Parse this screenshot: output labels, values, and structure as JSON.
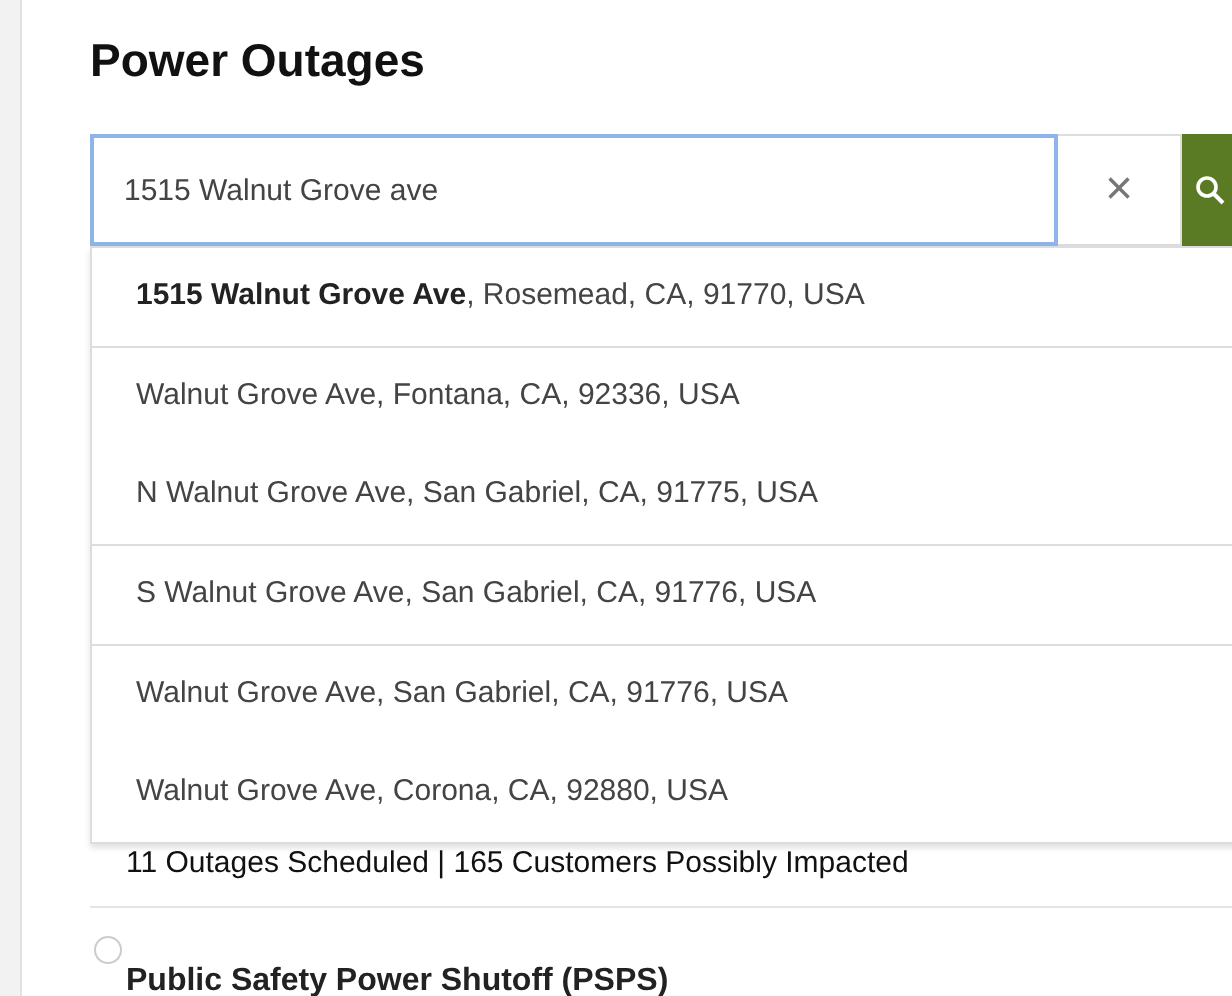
{
  "title": "Power Outages",
  "search": {
    "value": "1515 Walnut Grove ave",
    "clear_label": "×"
  },
  "suggestion_groups": [
    {
      "items": [
        "**1515 Walnut Grove Ave**, Rosemead, CA, 91770, USA"
      ]
    },
    {
      "items": [
        "Walnut Grove Ave, Fontana, CA, 92336, USA",
        "N Walnut Grove Ave, San Gabriel, CA, 91775, USA"
      ]
    },
    {
      "items": [
        "S Walnut Grove Ave, San Gabriel, CA, 91776, USA"
      ]
    },
    {
      "items": [
        "Walnut Grove Ave, San Gabriel, CA, 91776, USA",
        "Walnut Grove Ave, Corona, CA, 92880, USA"
      ]
    }
  ],
  "summary": "11 Outages Scheduled | 165 Customers Possibly Impacted",
  "section_title": "Public Safety Power Shutoff (PSPS)",
  "section_radio": {
    "selected": false
  }
}
